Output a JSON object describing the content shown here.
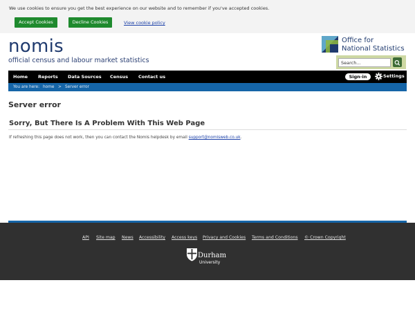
{
  "cookie": {
    "message": "We use cookies to ensure you get the best experience on our website and to remember if you've accepted cookies.",
    "accept_label": "Accept Cookies",
    "decline_label": "Decline Cookies",
    "view_policy_label": "View cookie policy",
    "button_color": "#1f8a2e"
  },
  "header": {
    "brand": "nomis",
    "tagline": "official census and labour market statistics",
    "ons_line1": "Office for",
    "ons_line2": "National Statistics",
    "search_placeholder": "Search..."
  },
  "nav": {
    "items": [
      "Home",
      "Reports",
      "Data Sources",
      "Census",
      "Contact us"
    ],
    "signin_label": "Sign-in",
    "settings_label": "Settings",
    "icons": [
      "gear-icon",
      "search-icon"
    ]
  },
  "breadcrumb": {
    "you_are_here": "You are here:",
    "home": "home",
    "separator": ">",
    "current": "Server error"
  },
  "main": {
    "title": "Server error",
    "subtitle": "Sorry, But There Is A Problem With This Web Page",
    "help_text": "If refreshing this page does not work, then you can contact the Nomis helpdesk by email",
    "help_email": "support@nomisweb.co.uk",
    "help_end": "."
  },
  "footer": {
    "links": [
      "API",
      "Site map",
      "News",
      "Accessibility",
      "Access keys",
      "Privacy and Cookies",
      "Terms and Conditions",
      "© Crown Copyright"
    ],
    "durham_name": "Durham",
    "durham_sub": "University"
  },
  "colors": {
    "navbar": "#000000",
    "breadcrumb": "#1565a8",
    "footer": "#303030",
    "brand": "#1f3a6e"
  }
}
